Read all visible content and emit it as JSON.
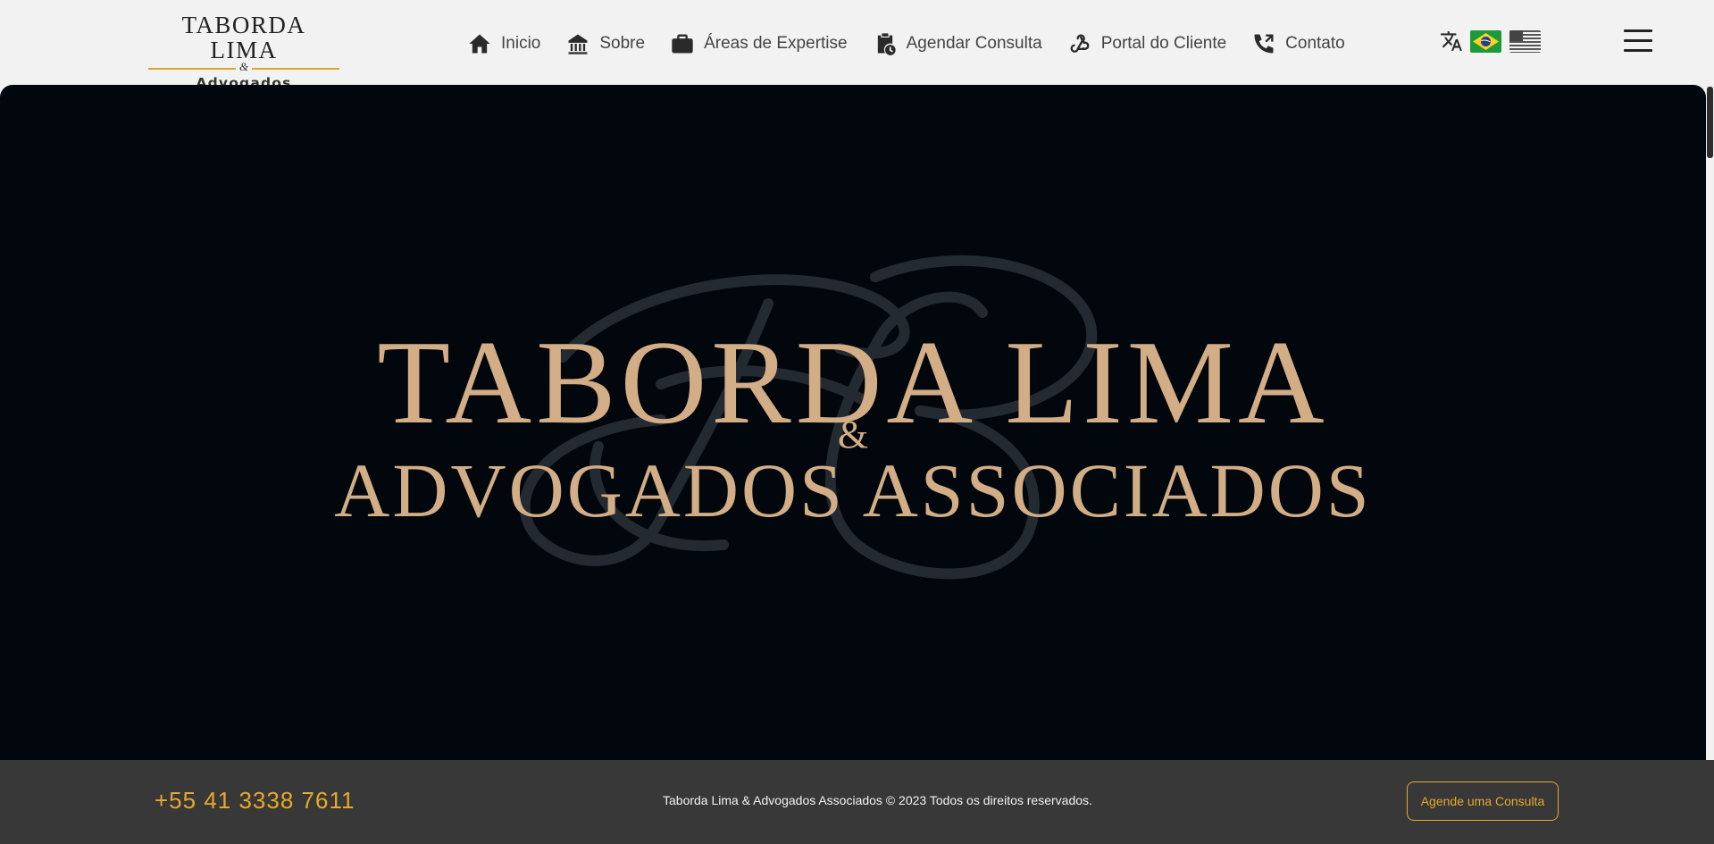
{
  "header": {
    "logo": {
      "title": "TABORDA LIMA",
      "ampersand": "&",
      "subtitle": "Advogados Associados"
    },
    "nav": [
      {
        "label": "Inicio",
        "icon": "home-icon"
      },
      {
        "label": "Sobre",
        "icon": "building-icon"
      },
      {
        "label": "Áreas de Expertise",
        "icon": "briefcase-icon"
      },
      {
        "label": "Agendar Consulta",
        "icon": "clipboard-clock-icon"
      },
      {
        "label": "Portal do Cliente",
        "icon": "webhook-icon"
      },
      {
        "label": "Contato",
        "icon": "phone-icon"
      }
    ],
    "language": {
      "icons": [
        "translate-icon",
        "brazil-flag",
        "usa-flag"
      ]
    },
    "menu_icon": "hamburger-icon"
  },
  "hero": {
    "line1": "TABORDA LIMA",
    "ampersand": "&",
    "line2": "ADVOGADOS ASSOCIADOS",
    "text_color": "#d2ad86",
    "background": "#02070d"
  },
  "footer": {
    "phone": "+55 41 3338 7611",
    "copyright": "Taborda Lima & Advogados Associados © 2023 Todos os direitos reservados.",
    "cta_label": "Agende uma Consulta",
    "accent": "#e6a92c",
    "background": "#383838"
  }
}
